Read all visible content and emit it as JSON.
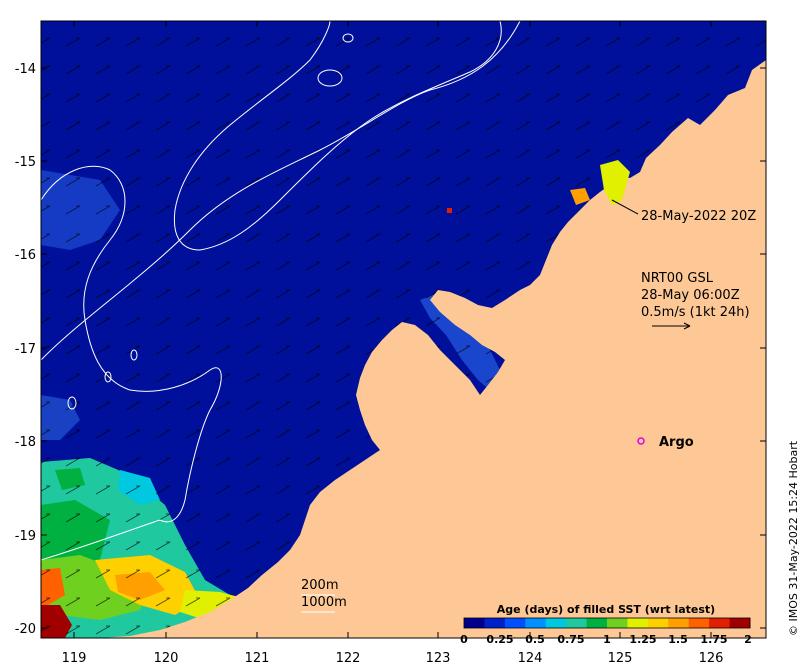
{
  "map": {
    "lon_ticks": [
      "119",
      "120",
      "121",
      "122",
      "123",
      "124",
      "125",
      "126"
    ],
    "lat_ticks": [
      "-14",
      "-15",
      "-16",
      "-17",
      "-18",
      "-19",
      "-20"
    ],
    "lon_range": [
      118.6,
      126.7
    ],
    "lat_range": [
      -20.2,
      -13.5
    ],
    "colors": {
      "ocean": "#00109a",
      "ocean_deep": "#000a80",
      "land": "#fdc896",
      "contour": "#ffffff",
      "shelf_blue": "#1e4fd6"
    }
  },
  "annotations": {
    "satellite_pass": "28-May-2022 20Z",
    "current_source": "NRT00 GSL",
    "current_time": "28-May 06:00Z",
    "current_scale": "0.5m/s (1kt 24h)",
    "argo_label": "Argo"
  },
  "isobaths": {
    "label_200": "200m",
    "label_1000": "1000m"
  },
  "colorbar": {
    "title": "Age (days) of filled SST (wrt latest)",
    "ticks": [
      "0",
      "0.25",
      "0.5",
      "0.75",
      "1",
      "1.25",
      "1.5",
      "1.75",
      "2"
    ],
    "colors": [
      "#00008f",
      "#0020c8",
      "#0050ff",
      "#0090ff",
      "#00c8e0",
      "#20c8a0",
      "#00b040",
      "#70d020",
      "#e0f000",
      "#ffd000",
      "#ffa000",
      "#ff6000",
      "#e02000",
      "#a00000"
    ]
  },
  "credit": "© IMOS 31-May-2022 15:24 Hobart"
}
